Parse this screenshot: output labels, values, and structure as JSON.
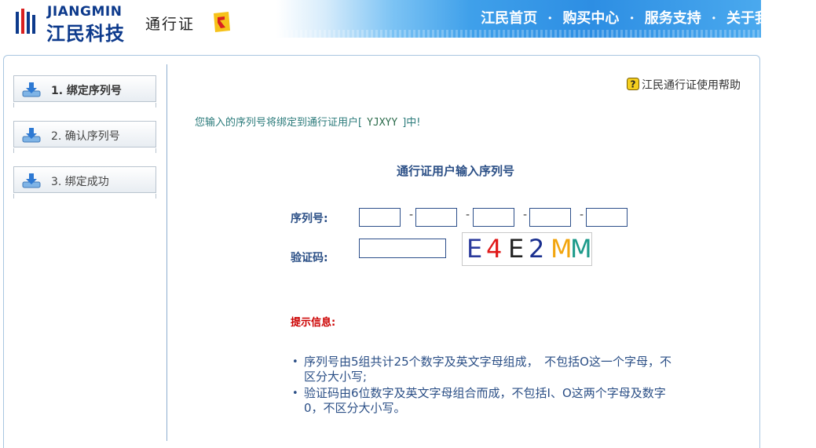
{
  "header": {
    "logo_en": "JIANGMIN",
    "logo_cn": "江民科技",
    "product": "通行证",
    "nav": [
      "江民首页",
      "购买中心",
      "服务支持",
      "关于我们"
    ],
    "nav_separator": "·"
  },
  "sidebar": {
    "steps": [
      {
        "label": "1. 绑定序列号",
        "active": true
      },
      {
        "label": "2. 确认序列号",
        "active": false
      },
      {
        "label": "3. 绑定成功",
        "active": false
      }
    ]
  },
  "help_link": "江民通行证使用帮助",
  "notice": {
    "prefix": "您输入的序列号将绑定到通行证用户[",
    "username": "YJXYY",
    "suffix": "]中!"
  },
  "form": {
    "title": "通行证用户输入序列号",
    "serial_label": "序列号:",
    "serial_values": [
      "",
      "",
      "",
      "",
      ""
    ],
    "serial_separator": "-",
    "code_label": "验证码:",
    "code_value": "",
    "captcha": [
      {
        "char": "E",
        "color": "#2a3a9c"
      },
      {
        "char": "4",
        "color": "#e01818"
      },
      {
        "char": "E",
        "color": "#222222"
      },
      {
        "char": "2",
        "color": "#1a2f8f"
      },
      {
        "char": "M",
        "color": "#f2a50e"
      },
      {
        "char": "M",
        "color": "#1d9a8a"
      }
    ]
  },
  "tips": {
    "title": "提示信息:",
    "items": [
      "序列号由5组共计25个数字及英文字母组成，　不包括O这一个字母，不区分大小写;",
      "验证码由6位数字及英文字母组合而成，不包括I、O这两个字母及数字0，不区分大小写。"
    ]
  },
  "colors": {
    "nav_blue": "#2d8ee3",
    "label_blue": "#2b4f86",
    "notice_teal": "#2a7a7a",
    "tip_red": "#cc0000"
  }
}
